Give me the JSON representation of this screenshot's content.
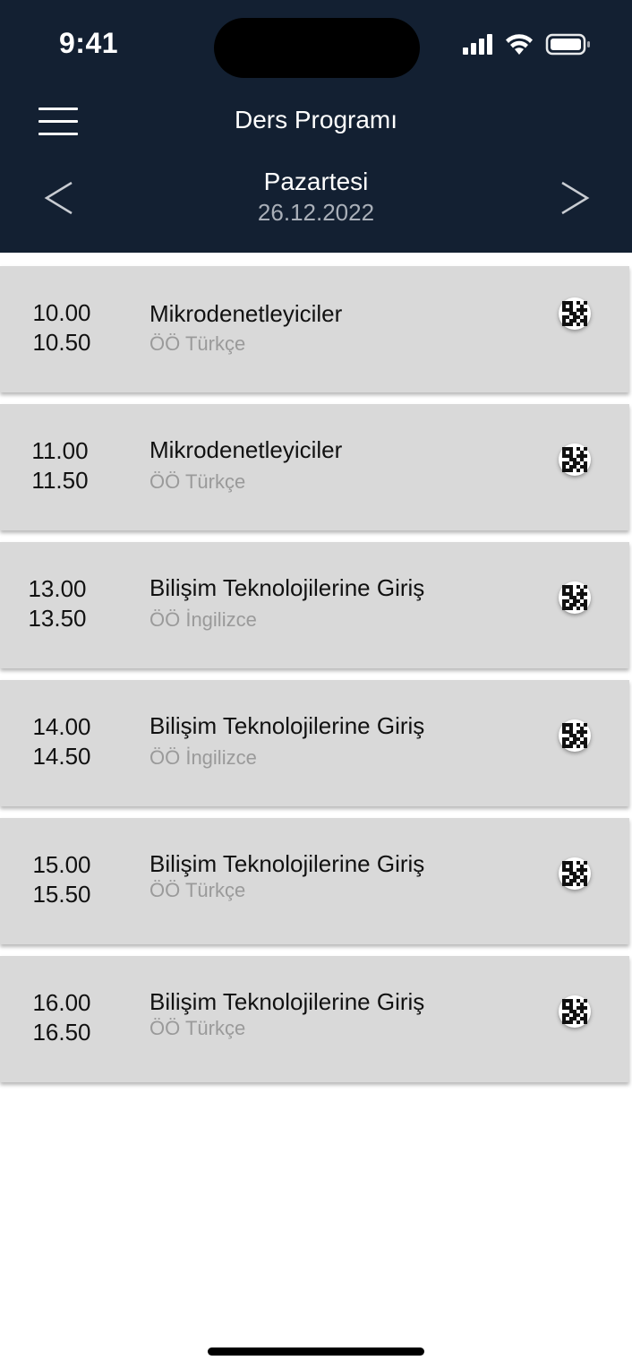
{
  "status_bar": {
    "time": "9:41"
  },
  "header": {
    "title": "Ders Programı",
    "day": "Pazartesi",
    "date": "26.12.2022"
  },
  "schedule": [
    {
      "start": "10.00",
      "end": "10.50",
      "course": "Mikrodenetleyiciler",
      "info": "ÖÖ Türkçe"
    },
    {
      "start": "11.00",
      "end": "11.50",
      "course": "Mikrodenetleyiciler",
      "info": "ÖÖ Türkçe"
    },
    {
      "start": "13.00",
      "end": "13.50",
      "course": "Bilişim Teknolojilerine Giriş",
      "info": "ÖÖ İngilizce"
    },
    {
      "start": "14.00",
      "end": "14.50",
      "course": "Bilişim Teknolojilerine Giriş",
      "info": "ÖÖ İngilizce"
    },
    {
      "start": "15.00",
      "end": "15.50",
      "course": "Bilişim Teknolojilerine Giriş",
      "info": "ÖÖ Türkçe"
    },
    {
      "start": "16.00",
      "end": "16.50",
      "course": "Bilişim Teknolojilerine Giriş",
      "info": "ÖÖ Türkçe"
    }
  ],
  "icons": {
    "menu": "hamburger-menu-icon",
    "prev": "chevron-left-icon",
    "next": "chevron-right-icon",
    "attendance": "qr-code-icon"
  },
  "colors": {
    "header_bg": "#132032",
    "row_bg": "#d9d9d9",
    "secondary_text": "#9a9a9a"
  }
}
